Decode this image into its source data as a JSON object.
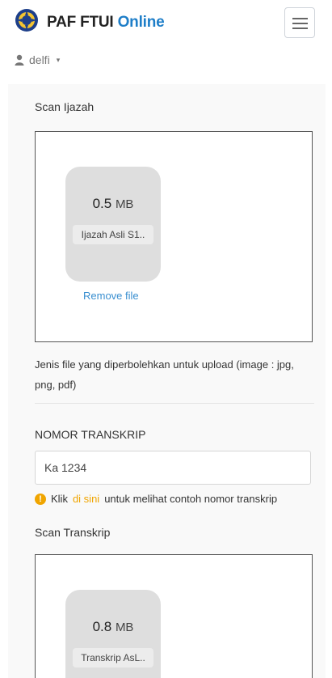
{
  "header": {
    "brand_name": "PAF FTUI",
    "brand_suffix": "Online",
    "logo_icon": "university-emblem-icon",
    "menu_icon": "hamburger-menu-icon"
  },
  "user": {
    "name": "delfi",
    "icon": "user-icon",
    "caret": "▾"
  },
  "ijazah": {
    "label": "Scan Ijazah",
    "file_size": "0.5",
    "file_unit": "MB",
    "file_name": "Ijazah Asli S1..",
    "remove_label": "Remove file"
  },
  "help_text": "Jenis file yang diperbolehkan untuk upload (image : jpg, png, pdf)",
  "transkrip_number": {
    "label": "NOMOR TRANSKRIP",
    "value": "Ka 1234",
    "hint_before": "Klik",
    "hint_link": "di sini",
    "hint_after": "untuk melihat contoh nomor transkrip"
  },
  "transkrip_scan": {
    "label": "Scan Transkrip",
    "file_size": "0.8",
    "file_unit": "MB",
    "file_name": "Transkrip AsL.."
  },
  "colors": {
    "accent": "#1e7ec8",
    "link": "#3a8fd0",
    "warning": "#f0a500"
  }
}
